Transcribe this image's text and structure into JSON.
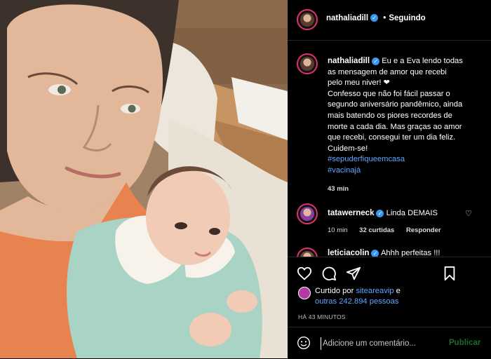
{
  "post": {
    "username": "nathaliadill",
    "follow_status": "Seguindo",
    "caption_lines": [
      "Eu e a Eva lendo todas",
      "as mensagem de amor que recebi",
      "pelo meu niver! ❤",
      "Confesso que não foi fácil passar o",
      "segundo aniversário pandêmico, ainda",
      "mais batendo os piores recordes de",
      "morte a cada dia. Mas graças ao amor",
      "que recebi, consegui ter um dia feliz.",
      "Cuidem-se!"
    ],
    "hashtags": [
      "#sepuderfiqueemcasa",
      "#vacinajá"
    ],
    "caption_time": "43 min"
  },
  "comments": [
    {
      "username": "tatawerneck",
      "text": "Linda DEMAIS",
      "time": "10 min",
      "likes": "32 curtidas",
      "reply": "Responder"
    },
    {
      "username": "leticiacolin",
      "text": "Ahhh perfeitas !!!"
    }
  ],
  "likes": {
    "prefix": "Curtido por",
    "liker": "siteareavip",
    "connector": "e",
    "others": "outras 242.894 pessoas"
  },
  "time_ago": "HÁ 43 MINUTOS",
  "comment_box": {
    "placeholder": "Adicione um comentário...",
    "publish_label": "Publicar"
  },
  "colors": {
    "background": "#000000",
    "link": "#5ea6ff",
    "verified": "#3897f0",
    "publish_disabled": "#1f6b2a"
  },
  "icons": [
    "heart-icon",
    "comment-icon",
    "share-icon",
    "bookmark-icon",
    "emoji-icon",
    "verified-icon"
  ]
}
